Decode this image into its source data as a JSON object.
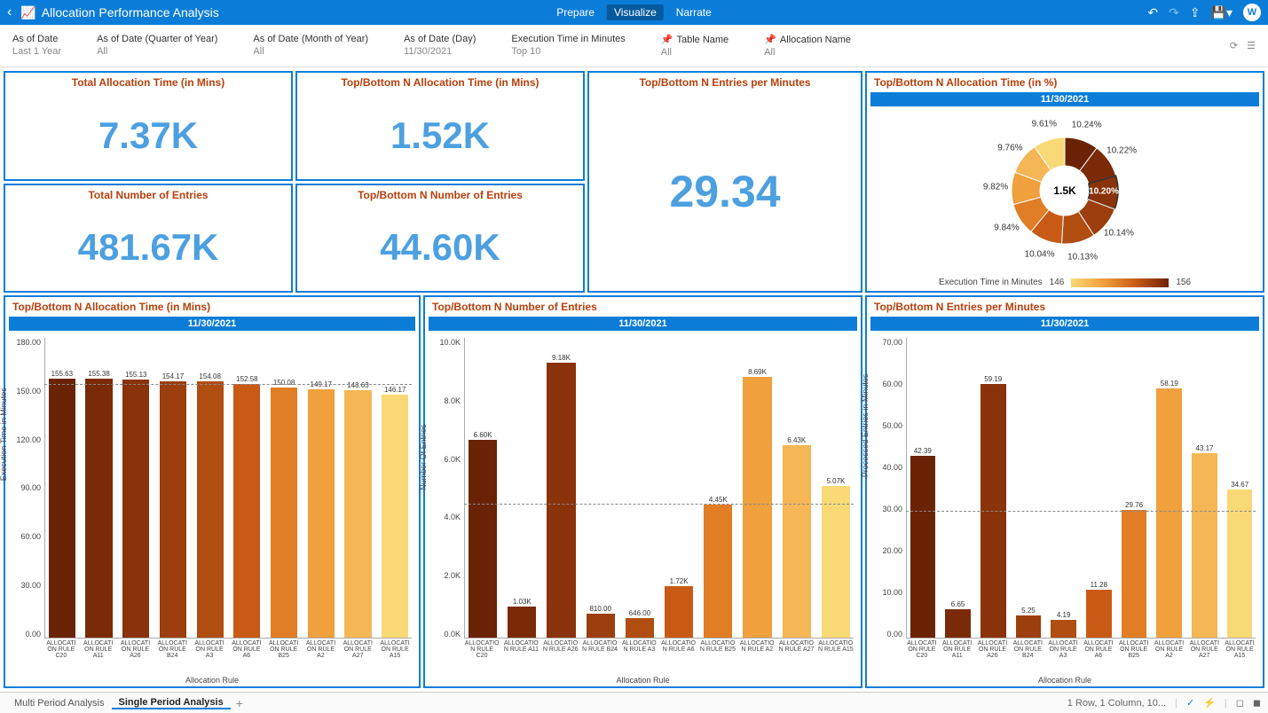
{
  "header": {
    "title": "Allocation Performance Analysis",
    "tabs": {
      "prepare": "Prepare",
      "visualize": "Visualize",
      "narrate": "Narrate"
    },
    "avatar": "W"
  },
  "filters": [
    {
      "label": "As of Date",
      "value": "Last 1 Year"
    },
    {
      "label": "As of Date (Quarter of Year)",
      "value": "All"
    },
    {
      "label": "As of Date (Month of Year)",
      "value": "All"
    },
    {
      "label": "As of Date (Day)",
      "value": "11/30/2021"
    },
    {
      "label": "Execution Time in Minutes",
      "value": "Top 10"
    },
    {
      "label": "Table Name",
      "value": "All",
      "pin": true
    },
    {
      "label": "Allocation Name",
      "value": "All",
      "pin": true
    }
  ],
  "kpis": {
    "total_alloc_time": {
      "title": "Total Allocation Time (in Mins)",
      "value": "7.37K"
    },
    "top_alloc_time": {
      "title": "Top/Bottom N Allocation Time (in Mins)",
      "value": "1.52K"
    },
    "total_entries": {
      "title": "Total Number of Entries",
      "value": "481.67K"
    },
    "top_entries": {
      "title": "Top/Bottom N Number of Entries",
      "value": "44.60K"
    },
    "entries_per_min": {
      "title": "Top/Bottom N Entries per Minutes",
      "value": "29.34"
    }
  },
  "donut": {
    "title": "Top/Bottom N Allocation Time (in %)",
    "subtitle": "11/30/2021",
    "center": "1.5K",
    "legend_label": "Execution Time in Minutes",
    "legend_min": "146",
    "legend_max": "156"
  },
  "bar1": {
    "title": "Top/Bottom N Allocation Time (in Mins)",
    "subtitle": "11/30/2021",
    "ylabel": "Execution Time in Minutes",
    "xtitle": "Allocation Rule"
  },
  "bar2": {
    "title": "Top/Bottom N Number of Entries",
    "subtitle": "11/30/2021",
    "ylabel": "Number Of Entries",
    "xtitle": "Allocation Rule"
  },
  "bar3": {
    "title": "Top/Bottom N Entries per Minutes",
    "subtitle": "11/30/2021",
    "ylabel": "Processed Entries in Minutes",
    "xtitle": "Allocation Rule"
  },
  "footer": {
    "tab1": "Multi Period Analysis",
    "tab2": "Single Period Analysis",
    "info": "1 Row, 1 Column, 10..."
  },
  "chart_data": [
    {
      "id": "donut",
      "type": "pie",
      "title": "Top/Bottom N Allocation Time (in %)",
      "center_total": "1.5K",
      "slices": [
        {
          "pct": 10.24,
          "color": "#6b2305"
        },
        {
          "pct": 10.22,
          "color": "#7a2a07"
        },
        {
          "pct": 10.2,
          "color": "#8a3209",
          "highlight": true
        },
        {
          "pct": 10.14,
          "color": "#9c3e0d"
        },
        {
          "pct": 10.13,
          "color": "#b04d11"
        },
        {
          "pct": 10.04,
          "color": "#c95a15"
        },
        {
          "pct": 9.84,
          "color": "#e07d25"
        },
        {
          "pct": 9.82,
          "color": "#f0a03c"
        },
        {
          "pct": 9.76,
          "color": "#f5b656"
        },
        {
          "pct": 9.61,
          "color": "#f9d976"
        }
      ],
      "legend": {
        "label": "Execution Time in Minutes",
        "min": 146,
        "max": 156
      }
    },
    {
      "id": "bar1",
      "type": "bar",
      "title": "Top/Bottom N Allocation Time (in Mins)",
      "ylabel": "Execution Time in Minutes",
      "xlabel": "Allocation Rule",
      "ylim": [
        0,
        180
      ],
      "yticks": [
        0.0,
        30.0,
        60.0,
        90.0,
        120.0,
        150.0,
        180.0
      ],
      "refline": 152,
      "categories": [
        "ALLOCATION RULE C20",
        "ALLOCATION RULE A11",
        "ALLOCATION RULE A26",
        "ALLOCATION RULE B24",
        "ALLOCATION RULE A3",
        "ALLOCATION RULE A6",
        "ALLOCATION RULE B25",
        "ALLOCATION RULE A2",
        "ALLOCATION RULE A27",
        "ALLOCATION RULE A15"
      ],
      "values": [
        155.63,
        155.38,
        155.13,
        154.17,
        154.08,
        152.58,
        150.08,
        149.17,
        148.63,
        146.17
      ],
      "labels": [
        "155.63",
        "155.38",
        "155.13",
        "154.17",
        "154.08",
        "152.58",
        "150.08",
        "149.17",
        "148.63",
        "146.17"
      ],
      "colors": [
        "#6b2305",
        "#7a2a07",
        "#8a3209",
        "#9c3e0d",
        "#b04d11",
        "#c95a15",
        "#e07d25",
        "#f0a03c",
        "#f5b656",
        "#f9d976"
      ]
    },
    {
      "id": "bar2",
      "type": "bar",
      "title": "Top/Bottom N Number of Entries",
      "ylabel": "Number Of Entries",
      "xlabel": "Allocation Rule",
      "ylim": [
        0,
        10000
      ],
      "yticks": [
        "0.0K",
        "2.0K",
        "4.0K",
        "6.0K",
        "8.0K",
        "10.0K"
      ],
      "refline": 4450,
      "categories": [
        "ALLOCATION RULE C20",
        "ALLOCATION RULE A11",
        "ALLOCATION RULE A26",
        "ALLOCATION RULE B24",
        "ALLOCATION RULE A3",
        "ALLOCATION RULE A6",
        "ALLOCATION RULE B25",
        "ALLOCATION RULE A2",
        "ALLOCATION RULE A27",
        "ALLOCATION RULE A15"
      ],
      "values": [
        6600,
        1030,
        9180,
        810,
        646,
        1720,
        4450,
        8690,
        6430,
        5070
      ],
      "labels": [
        "6.60K",
        "1.03K",
        "9.18K",
        "810.00",
        "646.00",
        "1.72K",
        "4.45K",
        "8.69K",
        "6.43K",
        "5.07K"
      ],
      "colors": [
        "#6b2305",
        "#7a2a07",
        "#8a3209",
        "#9c3e0d",
        "#b04d11",
        "#c95a15",
        "#e07d25",
        "#f0a03c",
        "#f5b656",
        "#f9d976"
      ]
    },
    {
      "id": "bar3",
      "type": "bar",
      "title": "Top/Bottom N Entries per Minutes",
      "ylabel": "Processed Entries in Minutes",
      "xlabel": "Allocation Rule",
      "ylim": [
        0,
        70
      ],
      "yticks": [
        0.0,
        10.0,
        20.0,
        30.0,
        40.0,
        50.0,
        60.0,
        70.0
      ],
      "refline": 29.5,
      "categories": [
        "ALLOCATION RULE C20",
        "ALLOCATION RULE A11",
        "ALLOCATION RULE A26",
        "ALLOCATION RULE B24",
        "ALLOCATION RULE A3",
        "ALLOCATION RULE A6",
        "ALLOCATION RULE B25",
        "ALLOCATION RULE A2",
        "ALLOCATION RULE A27",
        "ALLOCATION RULE A15"
      ],
      "values": [
        42.39,
        6.65,
        59.19,
        5.25,
        4.19,
        11.28,
        29.76,
        58.19,
        43.17,
        34.67
      ],
      "labels": [
        "42.39",
        "6.65",
        "59.19",
        "5.25",
        "4.19",
        "11.28",
        "29.76",
        "58.19",
        "43.17",
        "34.67"
      ],
      "colors": [
        "#6b2305",
        "#7a2a07",
        "#8a3209",
        "#9c3e0d",
        "#b04d11",
        "#c95a15",
        "#e07d25",
        "#f0a03c",
        "#f5b656",
        "#f9d976"
      ]
    }
  ]
}
